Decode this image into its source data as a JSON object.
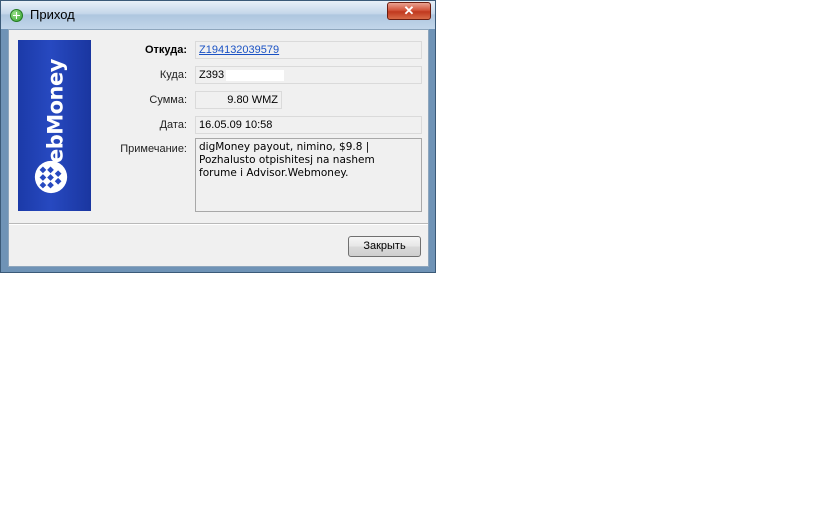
{
  "window": {
    "title": "Приход",
    "close_glyph": "✕"
  },
  "logo": {
    "brand": "WebMoney"
  },
  "fields": {
    "from_label": "Откуда:",
    "from_value": "Z194132039579",
    "to_label": "Куда:",
    "to_value": "Z393",
    "amount_label": "Сумма:",
    "amount_value": "9.80 WMZ",
    "date_label": "Дата:",
    "date_value": "16.05.09 10:58",
    "note_label": "Примечание:",
    "note_value": "digMoney payout, nimino, $9.8 |\nPozhalusto otpishitesj na nashem\nforume i Advisor.Webmoney."
  },
  "buttons": {
    "close_label": "Закрыть"
  },
  "colors": {
    "logo_blue": "#2749c0",
    "link": "#1a52c4",
    "titlebar": "#c5d7ea"
  }
}
